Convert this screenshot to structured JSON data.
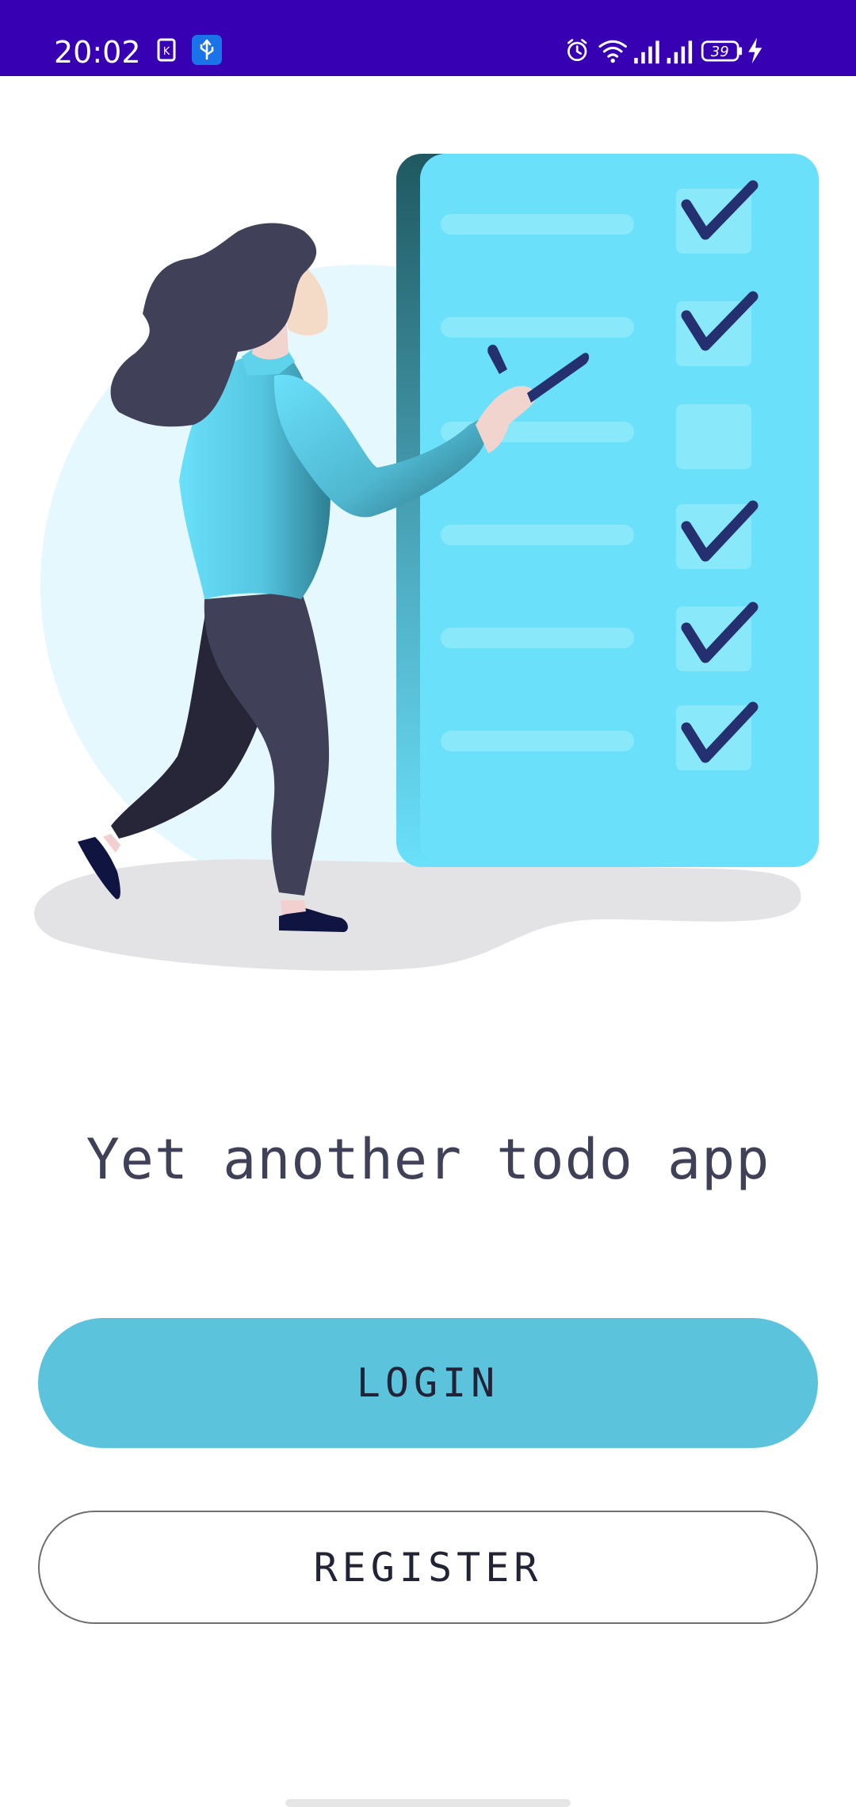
{
  "status_bar": {
    "time": "20:02",
    "left_icons": [
      "sim-card-icon",
      "usb-icon"
    ],
    "right_icons": [
      "alarm-icon",
      "wifi-icon",
      "signal-icon",
      "signal-icon",
      "battery-icon",
      "charging-icon"
    ],
    "battery_level": "39",
    "colors": {
      "background": "#3700b3"
    }
  },
  "illustration": {
    "icon": "woman-checklist-illustration",
    "checklist_checked": [
      true,
      true,
      false,
      true,
      true,
      true
    ]
  },
  "main": {
    "title": "Yet another todo app",
    "login_label": "LOGIN",
    "register_label": "REGISTER"
  },
  "colors": {
    "accent": "#5bc3db",
    "text": "#404058",
    "board": "#6ae0fa"
  }
}
